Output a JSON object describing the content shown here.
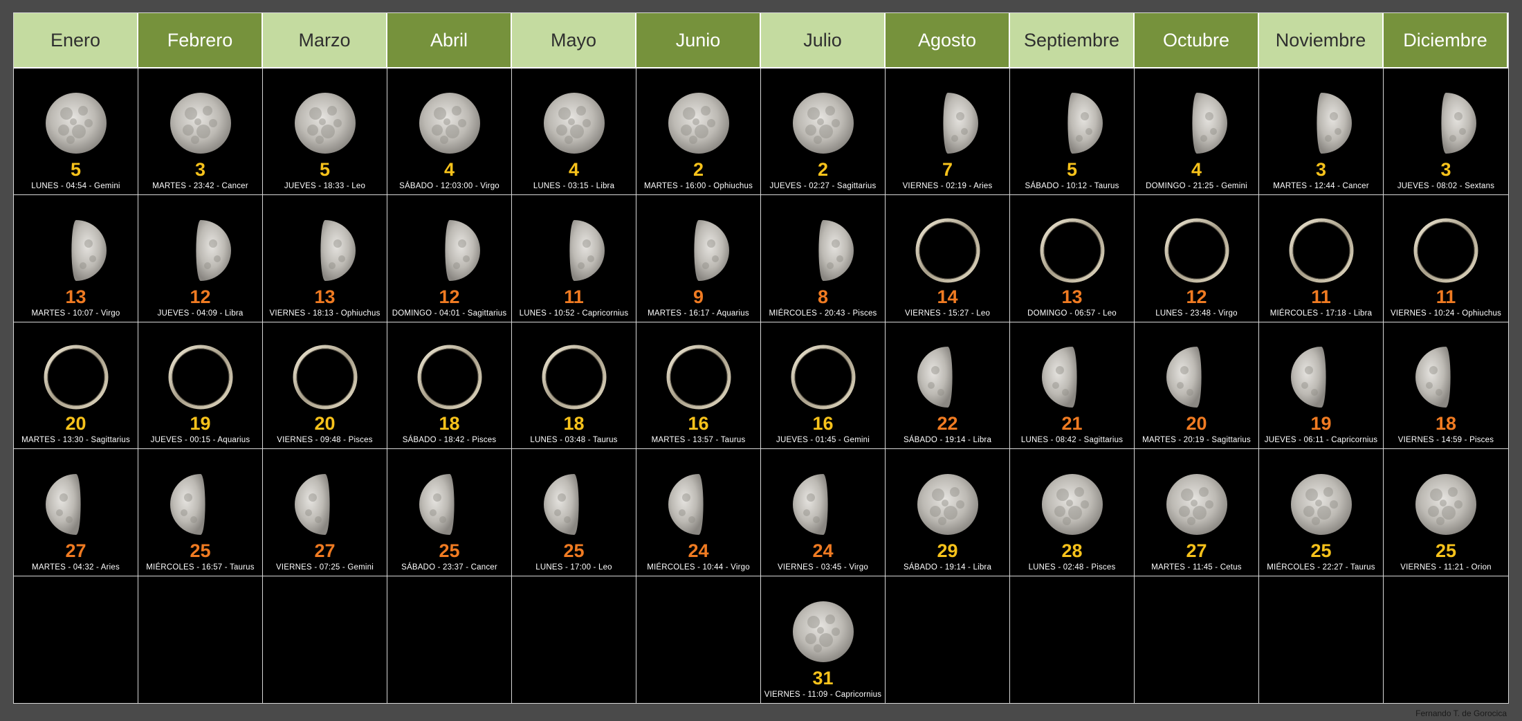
{
  "months": [
    "Enero",
    "Febrero",
    "Marzo",
    "Abril",
    "Mayo",
    "Junio",
    "Julio",
    "Agosto",
    "Septiembre",
    "Octubre",
    "Noviembre",
    "Diciembre"
  ],
  "rows": [
    [
      {
        "phase": "full",
        "day": "5",
        "info": "LUNES - 04:54 - Gemini"
      },
      {
        "phase": "full",
        "day": "3",
        "info": "MARTES - 23:42 - Cancer"
      },
      {
        "phase": "full",
        "day": "5",
        "info": "JUEVES - 18:33 - Leo"
      },
      {
        "phase": "full",
        "day": "4",
        "info": "SÁBADO - 12:03:00 - Virgo"
      },
      {
        "phase": "full",
        "day": "4",
        "info": "LUNES - 03:15 - Libra"
      },
      {
        "phase": "full",
        "day": "2",
        "info": "MARTES - 16:00 - Ophiuchus"
      },
      {
        "phase": "full",
        "day": "2",
        "info": "JUEVES - 02:27 - Sagittarius"
      },
      {
        "phase": "waning",
        "day": "7",
        "info": "VIERNES - 02:19 - Aries"
      },
      {
        "phase": "waning",
        "day": "5",
        "info": "SÁBADO - 10:12 - Taurus"
      },
      {
        "phase": "waning",
        "day": "4",
        "info": "DOMINGO - 21:25 - Gemini"
      },
      {
        "phase": "waning",
        "day": "3",
        "info": "MARTES - 12:44 - Cancer"
      },
      {
        "phase": "waning",
        "day": "3",
        "info": "JUEVES - 08:02 - Sextans"
      }
    ],
    [
      {
        "phase": "waning",
        "day": "13",
        "info": "MARTES - 10:07 - Virgo"
      },
      {
        "phase": "waning",
        "day": "12",
        "info": "JUEVES - 04:09 - Libra"
      },
      {
        "phase": "waning",
        "day": "13",
        "info": "VIERNES - 18:13 - Ophiuchus"
      },
      {
        "phase": "waning",
        "day": "12",
        "info": "DOMINGO - 04:01 - Sagittarius"
      },
      {
        "phase": "waning",
        "day": "11",
        "info": "LUNES - 10:52 - Capricornius"
      },
      {
        "phase": "waning",
        "day": "9",
        "info": "MARTES - 16:17 - Aquarius"
      },
      {
        "phase": "waning",
        "day": "8",
        "info": "MIÉRCOLES - 20:43 - Pisces"
      },
      {
        "phase": "new",
        "day": "14",
        "info": "VIERNES - 15:27 - Leo"
      },
      {
        "phase": "new",
        "day": "13",
        "info": "DOMINGO - 06:57 - Leo"
      },
      {
        "phase": "new",
        "day": "12",
        "info": "LUNES - 23:48 - Virgo"
      },
      {
        "phase": "new",
        "day": "11",
        "info": "MIÉRCOLES - 17:18 - Libra"
      },
      {
        "phase": "new",
        "day": "11",
        "info": "VIERNES - 10:24 - Ophiuchus"
      }
    ],
    [
      {
        "phase": "new",
        "day": "20",
        "info": "MARTES - 13:30 - Sagittarius"
      },
      {
        "phase": "new",
        "day": "19",
        "info": "JUEVES - 00:15 - Aquarius"
      },
      {
        "phase": "new",
        "day": "20",
        "info": "VIERNES - 09:48 - Pisces"
      },
      {
        "phase": "new",
        "day": "18",
        "info": "SÁBADO - 18:42 - Pisces"
      },
      {
        "phase": "new",
        "day": "18",
        "info": "LUNES - 03:48 - Taurus"
      },
      {
        "phase": "new",
        "day": "16",
        "info": "MARTES - 13:57 - Taurus"
      },
      {
        "phase": "new",
        "day": "16",
        "info": "JUEVES - 01:45 - Gemini"
      },
      {
        "phase": "waxing",
        "day": "22",
        "info": "SÁBADO - 19:14 - Libra"
      },
      {
        "phase": "waxing",
        "day": "21",
        "info": "LUNES - 08:42 - Sagittarius"
      },
      {
        "phase": "waxing",
        "day": "20",
        "info": "MARTES - 20:19 - Sagittarius"
      },
      {
        "phase": "waxing",
        "day": "19",
        "info": "JUEVES - 06:11 - Capricornius"
      },
      {
        "phase": "waxing",
        "day": "18",
        "info": "VIERNES - 14:59 - Pisces"
      }
    ],
    [
      {
        "phase": "waxing",
        "day": "27",
        "info": "MARTES - 04:32 - Aries"
      },
      {
        "phase": "waxing",
        "day": "25",
        "info": "MIÉRCOLES - 16:57 - Taurus"
      },
      {
        "phase": "waxing",
        "day": "27",
        "info": "VIERNES - 07:25 - Gemini"
      },
      {
        "phase": "waxing",
        "day": "25",
        "info": "SÁBADO - 23:37 - Cancer"
      },
      {
        "phase": "waxing",
        "day": "25",
        "info": "LUNES - 17:00 - Leo"
      },
      {
        "phase": "waxing",
        "day": "24",
        "info": "MIÉRCOLES - 10:44 - Virgo"
      },
      {
        "phase": "waxing",
        "day": "24",
        "info": "VIERNES - 03:45 - Virgo"
      },
      {
        "phase": "full",
        "day": "29",
        "info": "SÁBADO - 19:14 - Libra"
      },
      {
        "phase": "full",
        "day": "28",
        "info": "LUNES - 02:48 - Pisces"
      },
      {
        "phase": "full",
        "day": "27",
        "info": "MARTES - 11:45 - Cetus"
      },
      {
        "phase": "full",
        "day": "25",
        "info": "MIÉRCOLES - 22:27 - Taurus"
      },
      {
        "phase": "full",
        "day": "25",
        "info": "VIERNES - 11:21 - Orion"
      }
    ],
    [
      null,
      null,
      null,
      null,
      null,
      null,
      {
        "phase": "full",
        "day": "31",
        "info": "VIERNES - 11:09 - Capricornius"
      },
      null,
      null,
      null,
      null,
      null
    ]
  ],
  "credit": "Fernando T. de Gorocica",
  "colors": {
    "header_light": "#c4dba0",
    "header_dark": "#76923c",
    "day_yellow": "#f7c21b",
    "day_orange": "#f07b22"
  }
}
